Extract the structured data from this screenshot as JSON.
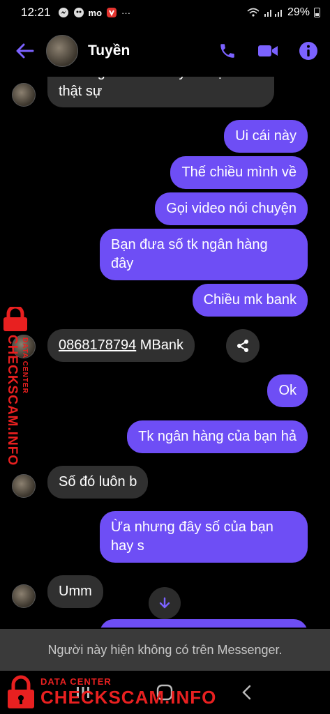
{
  "status_bar": {
    "time": "12:21",
    "battery": "29%",
    "notification_icons": [
      "messenger-icon",
      "app-icon",
      "mo-mo-icon",
      "vivaldi-icon",
      "more-icon"
    ]
  },
  "header": {
    "contact_name": "Tuyền",
    "icons": [
      "back-arrow-icon",
      "phone-icon",
      "video-icon",
      "info-icon"
    ],
    "accent_color": "#6e4ef5"
  },
  "messages": [
    {
      "from": "them",
      "text": "Làm ngủa hoàn mày về bậc thật sự",
      "lines": [
        "Làm ngủa hoàn mày về bậc",
        "thật sự"
      ]
    },
    {
      "from": "me",
      "text": "Ui cái này"
    },
    {
      "from": "me",
      "text": "Thế chiều mình về"
    },
    {
      "from": "me",
      "text": "Gọi video nói chuyện"
    },
    {
      "from": "me",
      "text": "Bạn đưa số tk ngân hàng đây",
      "lines": [
        "Bạn đưa số tk ngân hàng",
        "đây"
      ]
    },
    {
      "from": "me",
      "text": "Chiều mk  bank"
    },
    {
      "from": "them",
      "link": "0868178794",
      "text_after": " MBank"
    },
    {
      "from": "me",
      "text": "Ok"
    },
    {
      "from": "me",
      "text": "Tk ngân hàng của bạn hả"
    },
    {
      "from": "them",
      "text": "Số đó luôn b"
    },
    {
      "from": "me",
      "text": "Ừa nhưng đây số của bạn hay s",
      "lines": [
        "Ừa nhưng đây số của bạn",
        "hay s"
      ]
    },
    {
      "from": "them",
      "text": "Umm"
    }
  ],
  "bubble_colors": {
    "outgoing": "#6e4ef5",
    "incoming": "#303030"
  },
  "notice": "Người này hiện không có trên Messenger.",
  "watermark": {
    "small": "DATA CENTER",
    "big": "CHECKSCAM.INFO",
    "color": "#e82020"
  }
}
